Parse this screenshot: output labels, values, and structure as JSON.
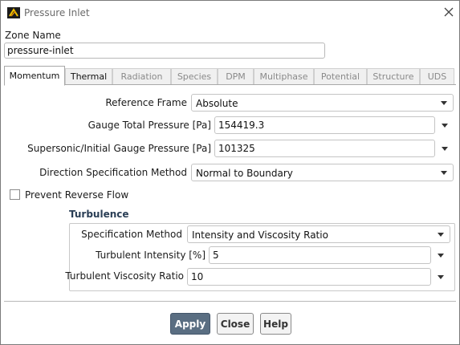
{
  "window": {
    "title": "Pressure Inlet"
  },
  "zone": {
    "label": "Zone Name",
    "value": "pressure-inlet"
  },
  "tabs": [
    {
      "label": "Momentum",
      "state": "active"
    },
    {
      "label": "Thermal",
      "state": "enabled"
    },
    {
      "label": "Radiation",
      "state": "disabled"
    },
    {
      "label": "Species",
      "state": "disabled"
    },
    {
      "label": "DPM",
      "state": "disabled"
    },
    {
      "label": "Multiphase",
      "state": "disabled"
    },
    {
      "label": "Potential",
      "state": "disabled"
    },
    {
      "label": "Structure",
      "state": "disabled"
    },
    {
      "label": "UDS",
      "state": "disabled"
    }
  ],
  "momentum": {
    "reference_frame": {
      "label": "Reference Frame",
      "value": "Absolute"
    },
    "gauge_total_pressure": {
      "label": "Gauge Total Pressure [Pa]",
      "value": "154419.3"
    },
    "supersonic_pressure": {
      "label": "Supersonic/Initial Gauge Pressure [Pa]",
      "value": "101325"
    },
    "direction_method": {
      "label": "Direction Specification Method",
      "value": "Normal to Boundary"
    },
    "prevent_reverse_flow": {
      "label": "Prevent Reverse Flow",
      "checked": false
    }
  },
  "turbulence": {
    "title": "Turbulence",
    "spec_method": {
      "label": "Specification Method",
      "value": "Intensity and Viscosity Ratio"
    },
    "intensity": {
      "label": "Turbulent Intensity [%]",
      "value": "5"
    },
    "viscosity_ratio": {
      "label": "Turbulent Viscosity Ratio",
      "value": "10"
    }
  },
  "buttons": {
    "apply": "Apply",
    "close": "Close",
    "help": "Help"
  },
  "colors": {
    "primary_button": "#5a6e82",
    "group_title": "#2a3e55"
  }
}
